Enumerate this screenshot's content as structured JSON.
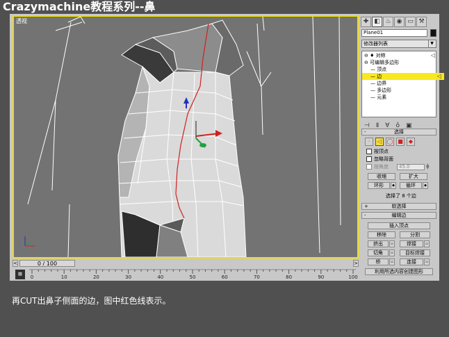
{
  "header": {
    "title": "Crazymachine教程系列--鼻"
  },
  "viewport": {
    "label": "透视",
    "border_color": "#f0e000"
  },
  "timeline": {
    "slider_text": "0 / 100",
    "left_arrow": "<",
    "right_arrow": ">"
  },
  "ruler": {
    "ticks": [
      "0",
      "10",
      "20",
      "30",
      "40",
      "50",
      "60",
      "70",
      "80",
      "90",
      "100"
    ],
    "key_label": "⊞"
  },
  "panel": {
    "tabs": [
      "✚",
      "◧",
      "♨",
      "◉",
      "▭",
      "⚒"
    ],
    "object_name": "Plane01",
    "object_color": "#111111",
    "modifier_list": "修改器列表",
    "stack": [
      {
        "label": "⊖ ♦ 对称",
        "selected": false
      },
      {
        "label": "⊖ 可编辑多边形",
        "selected": false
      },
      {
        "label": "— 顶点",
        "selected": false
      },
      {
        "label": "— 边",
        "selected": true
      },
      {
        "label": "— 边界",
        "selected": false
      },
      {
        "label": "— 多边形",
        "selected": false
      },
      {
        "label": "— 元素",
        "selected": false
      }
    ],
    "stack_tools": [
      "⊣",
      "Ⅱ",
      "∀",
      "ô",
      "▣"
    ],
    "selection": {
      "header": "选择",
      "header_sign": "-",
      "icons": [
        "·",
        "◁",
        "◯",
        "■",
        "◆"
      ],
      "by_vertex": "按顶点",
      "ignore_backfacing": "忽略背面",
      "by_angle": "按角度",
      "angle_value": "45.0",
      "shrink": "收缩",
      "grow": "扩大",
      "ring": "环形",
      "loop": "循环",
      "status": "选择了 8 个边"
    },
    "soft_selection": {
      "header": "软选择",
      "sign": "+"
    },
    "edit_edges": {
      "header": "编辑边",
      "sign": "-",
      "insert_vertex": "插入顶点",
      "remove": "移除",
      "split": "分割",
      "extrude": "挤出",
      "weld": "焊接",
      "chamfer": "切角",
      "target_weld": "目标焊接",
      "bridge": "桥",
      "connect": "连接",
      "create_shape": "利用所选内容创建图形"
    }
  },
  "caption": "再CUT出鼻子侧面的边，图中红色线表示。"
}
